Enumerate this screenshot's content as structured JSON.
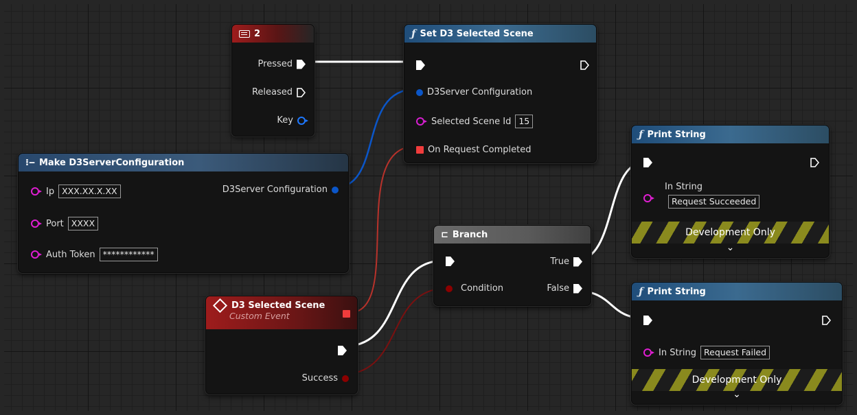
{
  "nodes": {
    "key_event": {
      "title": "2",
      "icon": "keyboard-icon",
      "pins": {
        "pressed": "Pressed",
        "released": "Released",
        "key": "Key"
      }
    },
    "set_scene": {
      "title": "Set D3 Selected Scene",
      "icon": "function-icon",
      "pins": {
        "config": "D3Server Configuration",
        "scene_id": "Selected Scene Id",
        "scene_id_value": "15",
        "on_request": "On Request Completed"
      }
    },
    "make_config": {
      "title": "Make D3ServerConfiguration",
      "icon": "make-struct-icon",
      "pins": {
        "ip": "Ip",
        "ip_value": "XXX.XX.X.XX",
        "port": "Port",
        "port_value": "XXXX",
        "auth": "Auth Token",
        "auth_value": "************",
        "output": "D3Server Configuration"
      }
    },
    "custom_event": {
      "title": "D3 Selected Scene",
      "subtitle": "Custom Event",
      "icon": "event-diamond-icon",
      "pins": {
        "success": "Success"
      }
    },
    "branch": {
      "title": "Branch",
      "icon": "branch-icon",
      "pins": {
        "condition": "Condition",
        "true": "True",
        "false": "False"
      }
    },
    "print_success": {
      "title": "Print String",
      "icon": "function-icon",
      "pins": {
        "in_string": "In String",
        "value": "Request Succeeded"
      },
      "dev_label": "Development Only"
    },
    "print_fail": {
      "title": "Print String",
      "icon": "function-icon",
      "pins": {
        "in_string": "In String",
        "value": "Request Failed"
      },
      "dev_label": "Development Only"
    }
  },
  "colors": {
    "exec": "#ffffff",
    "struct": "#0058d6",
    "int": "#d71fd0",
    "delegate": "#f03c3c",
    "bool": "#8c0000",
    "event_header": "#9e1c1c",
    "function_header": "#3b6a8f"
  }
}
